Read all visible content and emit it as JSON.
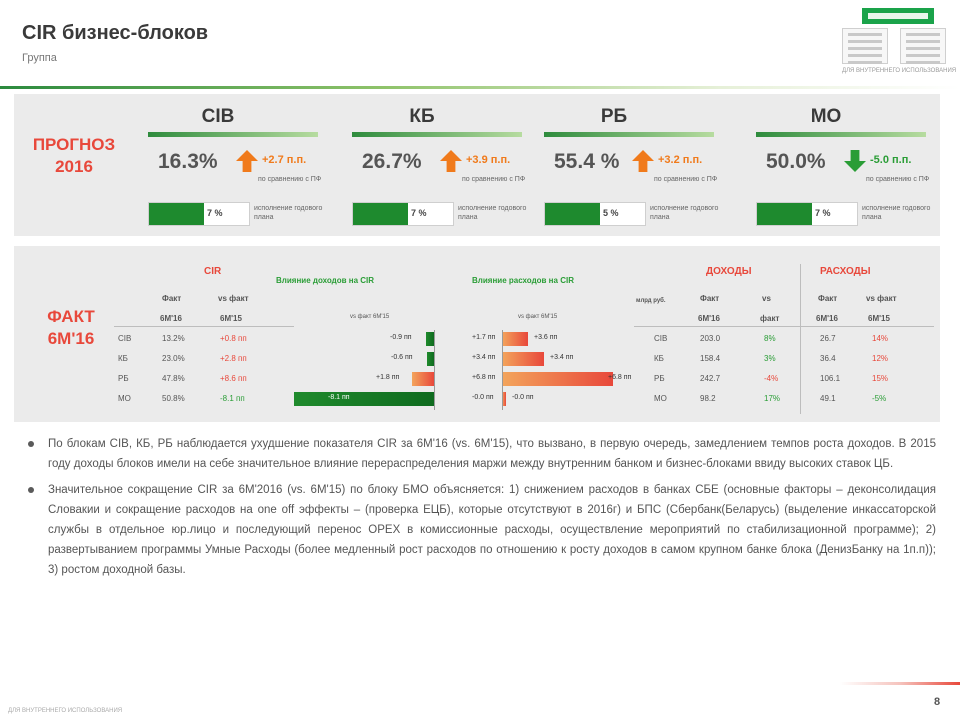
{
  "header": {
    "title": "CIR бизнес-блоков",
    "subtitle": "Группа"
  },
  "logo": {
    "caption": "ДЛЯ ВНУТРЕННЕГО ИСПОЛЬЗОВАНИЯ"
  },
  "forecast": {
    "label": "ПРОГНОЗ 2016",
    "blocks": [
      {
        "name": "CIB",
        "value": "16.3%",
        "direction": "up",
        "delta": "+2.7 п.п.",
        "delta_note": "по сравнению с ПФ",
        "progress": 0.55,
        "progress_value": "7 %",
        "progress_note": "исполнение годового плана"
      },
      {
        "name": "КБ",
        "value": "26.7%",
        "direction": "up",
        "delta": "+3.9 п.п.",
        "delta_note": "по сравнению с ПФ",
        "progress": 0.55,
        "progress_value": "7 %",
        "progress_note": "исполнение годового плана"
      },
      {
        "name": "РБ",
        "value": "55.4 %",
        "direction": "up",
        "delta": "+3.2 п.п.",
        "delta_note": "по сравнению с ПФ",
        "progress": 0.55,
        "progress_value": "5 %",
        "progress_note": "исполнение годового плана"
      },
      {
        "name": "МО",
        "value": "50.0%",
        "direction": "down",
        "delta": "-5.0 п.п.",
        "delta_note": "по сравнению с ПФ",
        "progress": 0.55,
        "progress_value": "7 %",
        "progress_note": "исполнение годового плана"
      }
    ]
  },
  "fact": {
    "label": "ФАКТ 6М'16",
    "cir_header": "CIR",
    "col_fact": "Факт",
    "col_vs": "vs факт",
    "period_a": "6М'16",
    "period_b": "6М'15",
    "infl_income_header": "Влияние доходов на CIR",
    "infl_expense_header": "Влияние расходов на CIR",
    "infl_income_sub": "vs факт 6М'15",
    "infl_expense_sub": "vs факт 6М'15",
    "income_header": "ДОХОДЫ",
    "expense_header": "РАСХОДЫ",
    "col_vs_short": "vs",
    "col_fact2": "факт",
    "unit_label": "млрд руб.",
    "rows": [
      {
        "block": "CIB",
        "cir": "13.2%",
        "cir_vs": "+0.8 пп",
        "cir_vs_sign": "neg",
        "inc_effect": "-0.9 пп",
        "inc_frac": 0.06,
        "exp_label": "+1.7 пп",
        "exp_effect": "+3.6 пп",
        "exp_frac": 0.2,
        "income": "203.0",
        "income_vs": "8%",
        "income_vs_sign": "pos",
        "expense": "26.7",
        "expense_vs": "14%",
        "expense_vs_sign": "neg"
      },
      {
        "block": "КБ",
        "cir": "23.0%",
        "cir_vs": "+2.8 пп",
        "cir_vs_sign": "neg",
        "inc_effect": "-0.6 пп",
        "inc_frac": 0.05,
        "exp_label": "+3.4 пп",
        "exp_effect": "+3.4 пп",
        "exp_frac": 0.32,
        "income": "158.4",
        "income_vs": "3%",
        "income_vs_sign": "pos",
        "expense": "36.4",
        "expense_vs": "12%",
        "expense_vs_sign": "neg"
      },
      {
        "block": "РБ",
        "cir": "47.8%",
        "cir_vs": "+8.6 пп",
        "cir_vs_sign": "neg",
        "inc_effect": "+1.8 пп",
        "inc_frac": 0.16,
        "exp_label": "+6.8 пп",
        "exp_effect": "+6.8 пп",
        "exp_frac": 0.85,
        "income": "242.7",
        "income_vs": "-4%",
        "income_vs_sign": "neg",
        "expense": "106.1",
        "expense_vs": "15%",
        "expense_vs_sign": "neg"
      },
      {
        "block": "МО",
        "cir": "50.8%",
        "cir_vs": "-8.1 пп",
        "cir_vs_sign": "pos",
        "inc_effect": "-8.1 пп",
        "inc_frac": 1.0,
        "exp_label": "-0.0 пп",
        "exp_effect": "-0.0 пп",
        "exp_frac": 0.03,
        "income": "98.2",
        "income_vs": "17%",
        "income_vs_sign": "pos",
        "expense": "49.1",
        "expense_vs": "-5%",
        "expense_vs_sign": "pos"
      }
    ]
  },
  "bullets": [
    "По блокам CIB, КБ, РБ наблюдается ухудшение показателя CIR за 6М'16 (vs. 6М'15), что вызвано, в первую очередь, замедлением темпов роста доходов. В 2015 году доходы блоков имели на себе значительное влияние перераспределения маржи между внутренним банком и бизнес-блоками ввиду высоких ставок ЦБ.",
    "Значительное сокращение CIR за 6М'2016 (vs. 6М'15) по блоку БМО объясняется: 1) снижением расходов в банках СБЕ (основные факторы – деконсолидация Словакии и сокращение расходов на one off эффекты – (проверка ЕЦБ), которые отсутствуют в 2016г) и БПС (Сбербанк(Беларусь) (выделение инкассаторской службы в отдельное юр.лицо и последующий перенос ОРЕХ в комиссионные расходы, осуществление мероприятий по стабилизационной программе); 2) развертыванием программы Умные Расходы (более медленный рост расходов по отношению к росту доходов в самом крупном банке блока (ДенизБанку на 1п.п)); 3) ростом доходной базы."
  ],
  "footer": {
    "page_number": "8",
    "note": "ДЛЯ ВНУТРЕННЕГО ИСПОЛЬЗОВАНИЯ"
  },
  "colors": {
    "accent_red": "#e8483b",
    "accent_green": "#2a9d36",
    "accent_orange": "#f07a1b",
    "panel_bg": "#ebebeb"
  }
}
